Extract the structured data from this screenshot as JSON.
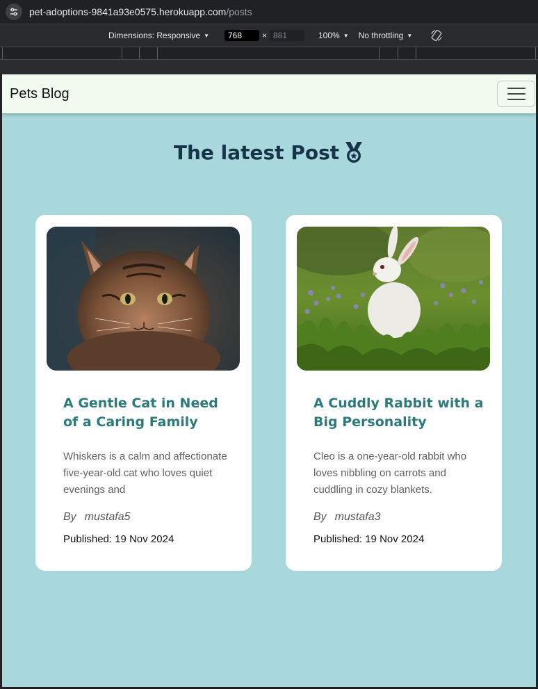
{
  "browser": {
    "url_host": "pet-adoptions-9841a93e0575.herokuapp.com",
    "url_path": "/posts"
  },
  "devtools": {
    "dimensions_label": "Dimensions: Responsive",
    "width_value": "768",
    "height_value": "881",
    "zoom": "100%",
    "throttling": "No throttling"
  },
  "navbar": {
    "brand": "Pets Blog"
  },
  "page": {
    "heading": "The latest Post",
    "heading_icon": "award-medal-icon"
  },
  "posts": [
    {
      "image": "kitten-photo",
      "title": "A Gentle Cat in Need of a Caring Family",
      "excerpt": "Whiskers is a calm and affectionate five-year-old cat who loves quiet evenings and",
      "by": "By",
      "author": "mustafa5",
      "published": "Published: 19 Nov 2024"
    },
    {
      "image": "white-rabbit-photo",
      "title": "A Cuddly Rabbit with a Big Personality",
      "excerpt": "Cleo is a one-year-old rabbit who loves nibbling on carrots and cuddling in cozy blankets.",
      "by": "By",
      "author": "mustafa3",
      "published": "Published: 19 Nov 2024"
    }
  ],
  "colors": {
    "page_background": "#a8d8dc",
    "navbar_background": "#f3faf0",
    "heading": "#17344a",
    "post_title": "#2d7a7c"
  }
}
